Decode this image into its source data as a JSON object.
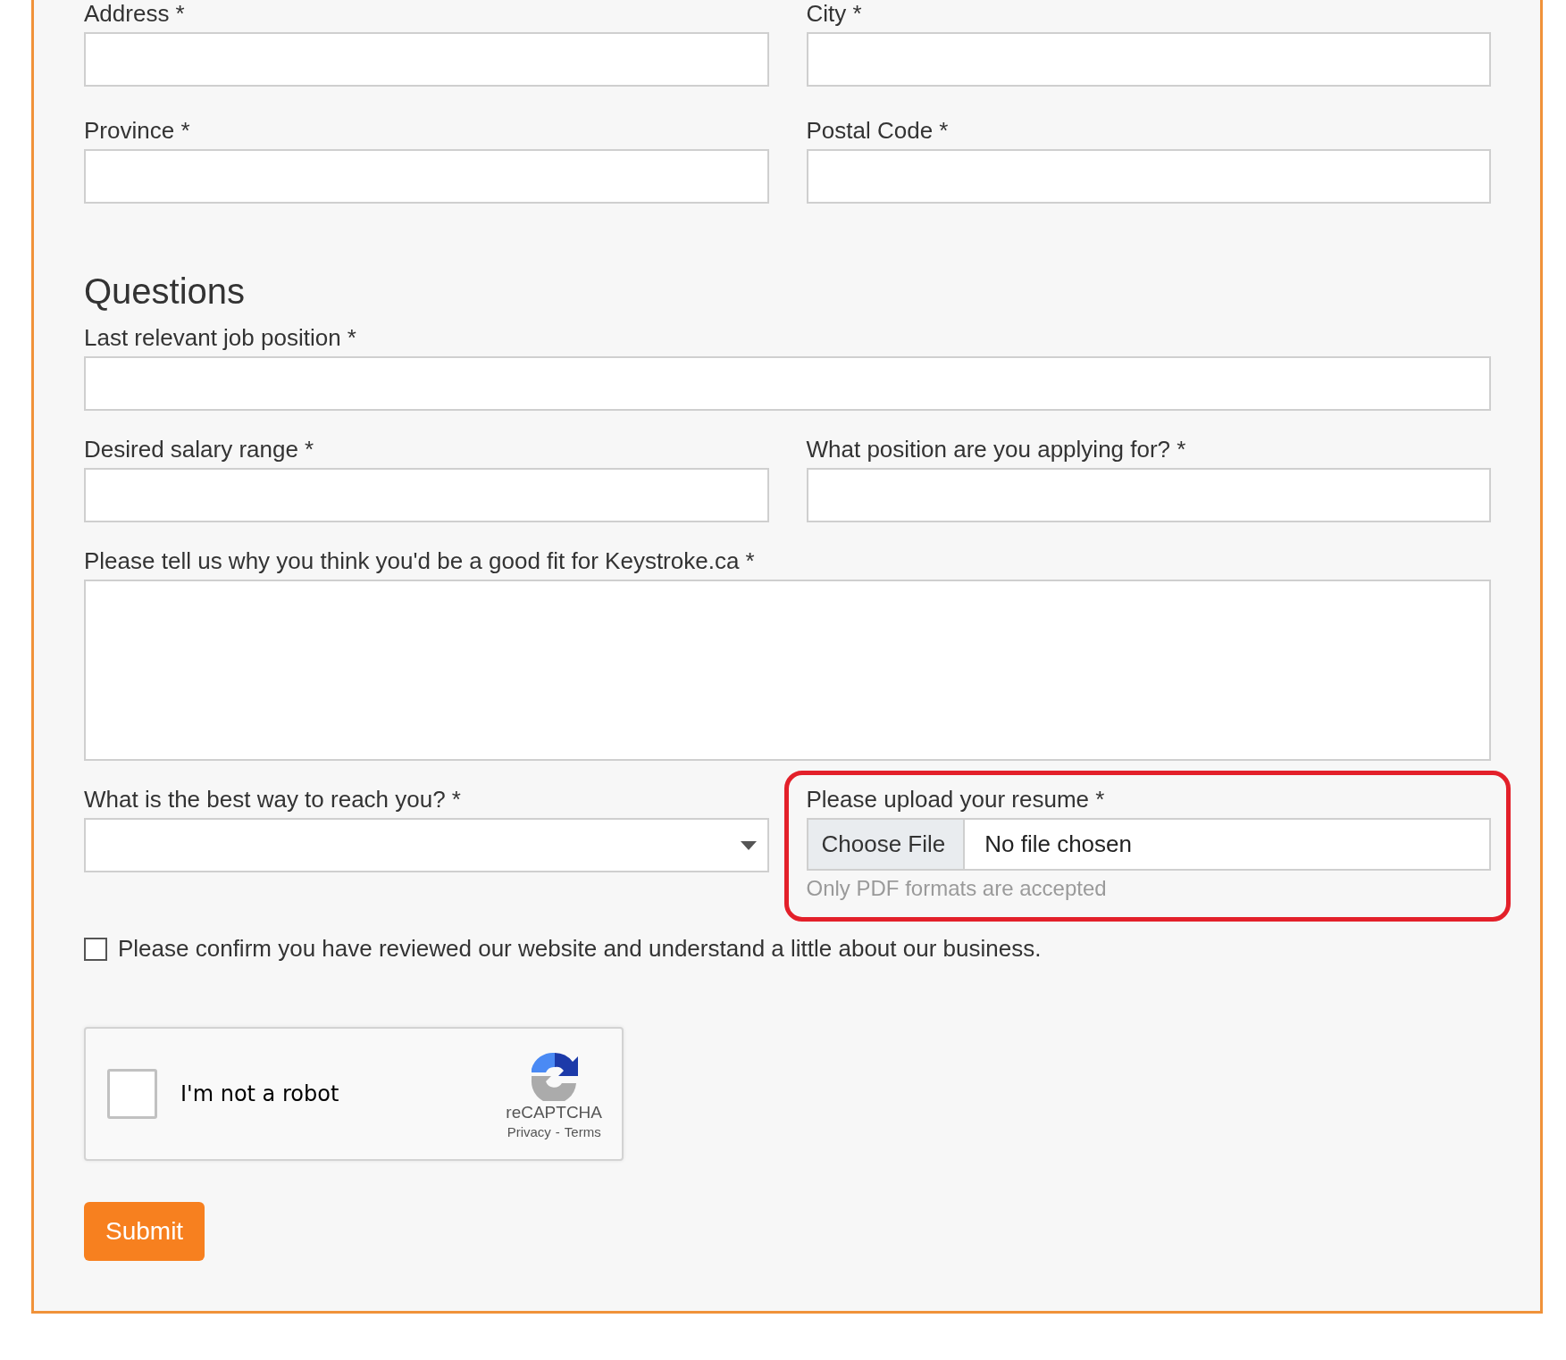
{
  "contact_fields": [
    {
      "label": "Address *"
    },
    {
      "label": "City *"
    },
    {
      "label": "Province *"
    },
    {
      "label": "Postal Code *"
    }
  ],
  "questions": {
    "heading": "Questions",
    "fields": [
      {
        "kind": "wide-text",
        "label": "Last relevant job position *"
      },
      {
        "kind": "text",
        "label": "Desired salary range *"
      },
      {
        "kind": "text",
        "label": "What position are you applying for? *"
      },
      {
        "kind": "textarea",
        "label": "Please tell us why you think you'd be a good fit for Keystroke.ca *"
      },
      {
        "kind": "select",
        "label": "What is the best way to reach you? *"
      },
      {
        "kind": "file",
        "label": "Please upload your resume *",
        "button": "Choose File",
        "status": "No file chosen",
        "hint": "Only PDF formats are accepted",
        "highlighted": true
      }
    ]
  },
  "confirm": {
    "label": "Please confirm you have reviewed our website and understand a little about our business.",
    "checked": false
  },
  "recaptcha": {
    "label": "I'm not a robot",
    "checked": false,
    "brand": "reCAPTCHA",
    "links": [
      "Privacy",
      "Terms"
    ],
    "separator": "-"
  },
  "submit": "Submit"
}
